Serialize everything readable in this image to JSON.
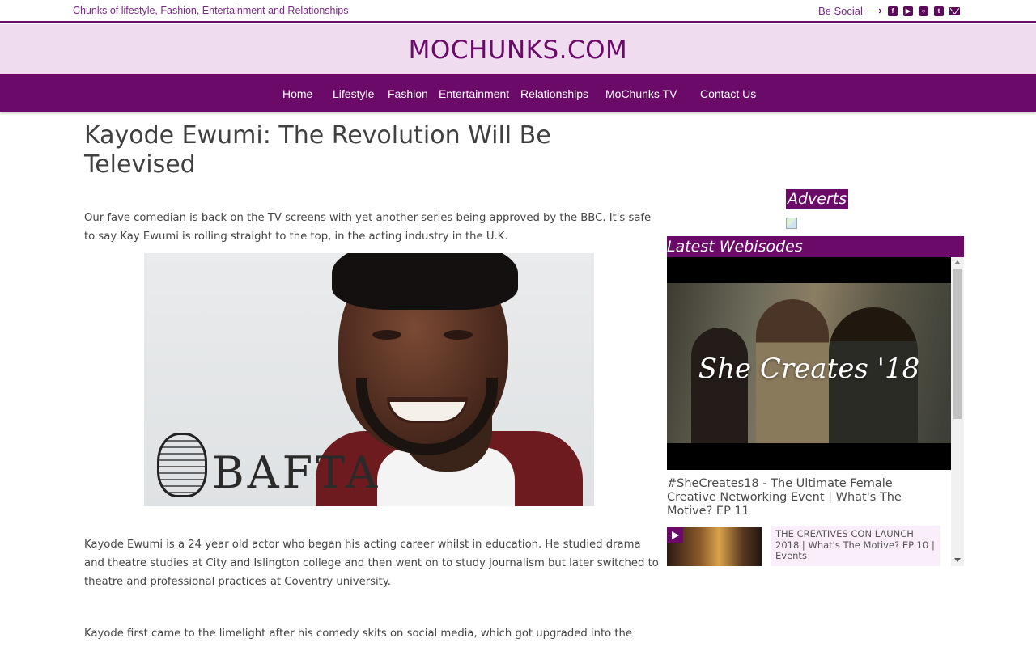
{
  "topbar": {
    "tagline": "Chunks of lifestyle, Fashion, Entertainment and Relationships",
    "social_label": "Be Social",
    "social_icons": [
      "facebook-icon",
      "youtube-icon",
      "instagram-icon",
      "twitter-icon",
      "email-icon"
    ]
  },
  "site": {
    "logo": "MOCHUNKS.COM"
  },
  "nav": {
    "items": [
      {
        "label": "Home"
      },
      {
        "label": "Lifestyle"
      },
      {
        "label": "Fashion"
      },
      {
        "label": "Entertainment"
      },
      {
        "label": "Relationships"
      },
      {
        "label": "MoChunks TV"
      },
      {
        "label": "Contact Us"
      }
    ]
  },
  "article": {
    "title": "Kayode Ewumi: The Revolution Will Be Televised",
    "paragraphs": [
      "Our fave comedian is back on the TV screens with yet another series being approved by the BBC. It's safe to say Kay Ewumi is rolling straight to the top, in the acting industry in the U.K.",
      "Kayode Ewumi is a 24 year old actor who began his acting career whilst in education. He studied drama and theatre studies at City and Islington college and then went on to study journalism but later switched to theatre and professional practices at Coventry university.",
      "Kayode first came to the limelight after his comedy skits on social media, which got upgraded into the"
    ],
    "image_text": "BAFTA"
  },
  "sidebar": {
    "adverts_title": "Adverts",
    "webisodes_title": "Latest Webisodes",
    "video": {
      "overlay_text": "She Creates '18",
      "title": "#SheCreates18 - The Ultimate Female Creative Networking Event | What's The Motive? EP 11"
    },
    "items": [
      {
        "title": "THE CREATIVES CON LAUNCH 2018 | What's The Motive? EP 10 | Events"
      }
    ]
  },
  "colors": {
    "brand": "#6b0a69",
    "header_bg": "#efdcef",
    "text": "#444444"
  }
}
